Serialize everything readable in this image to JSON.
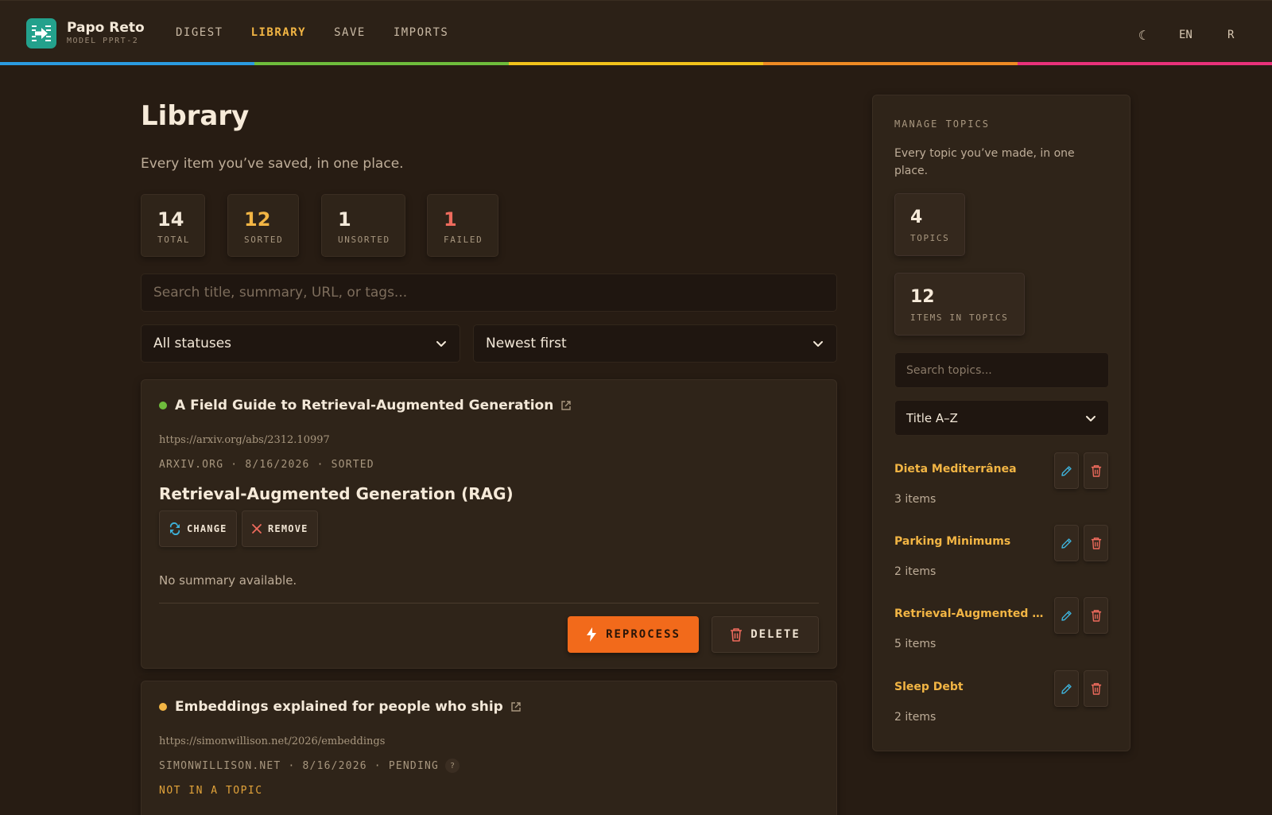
{
  "app": {
    "name": "Papo Reto",
    "model": "MODEL PPRT-2"
  },
  "nav": [
    {
      "label": "DIGEST",
      "active": false
    },
    {
      "label": "LIBRARY",
      "active": true
    },
    {
      "label": "SAVE",
      "active": false
    },
    {
      "label": "IMPORTS",
      "active": false
    }
  ],
  "top_right": {
    "theme_icon": "moon-icon",
    "theme_glyph": "☾",
    "language": "EN",
    "user_initial": "R"
  },
  "rainbow": [
    "#2b9be0",
    "#6fbd3c",
    "#f2c21b",
    "#ef8a24",
    "#e9317a"
  ],
  "page": {
    "title": "Library",
    "subtitle": "Every item you’ve saved, in one place."
  },
  "stats": [
    {
      "value": "14",
      "label": "TOTAL",
      "color": "#f3e8d8"
    },
    {
      "value": "12",
      "label": "SORTED",
      "color": "#f2b544"
    },
    {
      "value": "1",
      "label": "UNSORTED",
      "color": "#f3e8d8"
    },
    {
      "value": "1",
      "label": "FAILED",
      "color": "#ee6b5d"
    }
  ],
  "search": {
    "placeholder": "Search title, summary, URL, or tags...",
    "value": ""
  },
  "filters": {
    "status": "All statuses",
    "sort": "Newest first"
  },
  "items": [
    {
      "title": "A Field Guide to Retrieval-Augmented Generation",
      "status_color": "#6fbd3c",
      "url": "https://arxiv.org/abs/2312.10997",
      "meta": "ARXIV.ORG · 8/16/2026 · SORTED",
      "topic": "Retrieval-Augmented Generation (RAG)",
      "change_label": "CHANGE",
      "remove_label": "REMOVE",
      "summary": "No summary available.",
      "reprocess_label": "REPROCESS",
      "delete_label": "DELETE"
    },
    {
      "title": "Embeddings explained for people who ship",
      "status_color": "#f2b544",
      "url": "https://simonwillison.net/2026/embeddings",
      "meta": "SIMONWILLISON.NET · 8/16/2026 · PENDING",
      "help": "?",
      "topic_state": "NOT IN A TOPIC"
    }
  ],
  "sidebar": {
    "heading": "MANAGE TOPICS",
    "subtitle": "Every topic you’ve made, in one place.",
    "stats": [
      {
        "value": "4",
        "label": "TOPICS"
      },
      {
        "value": "12",
        "label": "ITEMS IN TOPICS"
      }
    ],
    "search_placeholder": "Search topics...",
    "sort": "Title A–Z",
    "topics": [
      {
        "name": "Dieta Mediterrânea",
        "count": "3 items"
      },
      {
        "name": "Parking Minimums",
        "count": "2 items"
      },
      {
        "name": "Retrieval-Augmented Generation (RAG)",
        "count": "5 items"
      },
      {
        "name": "Sleep Debt",
        "count": "2 items"
      }
    ]
  },
  "colors": {
    "background": "#271c13",
    "accent": "#f2b544",
    "primary_button": "#f26a1b",
    "logo": "#23a18c",
    "edit_icon": "#3db0d8",
    "delete_icon": "#ee6b5d"
  }
}
